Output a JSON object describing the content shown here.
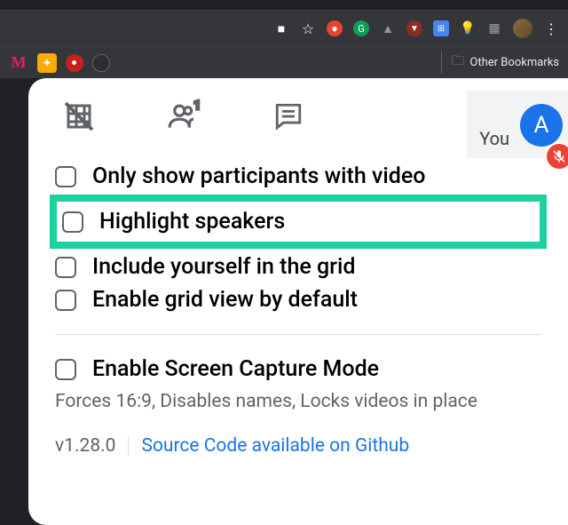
{
  "browser": {
    "bookmarks_label": "Other Bookmarks"
  },
  "meet": {
    "you_label": "You",
    "avatar_letter": "A"
  },
  "options": {
    "only_video": "Only show participants with video",
    "highlight_speakers": "Highlight speakers",
    "include_yourself": "Include yourself in the grid",
    "enable_default": "Enable grid view by default",
    "screen_capture": "Enable Screen Capture Mode",
    "screen_capture_desc": "Forces 16:9, Disables names, Locks videos in place"
  },
  "footer": {
    "version": "v1.28.0",
    "source_link": "Source Code available on Github"
  }
}
